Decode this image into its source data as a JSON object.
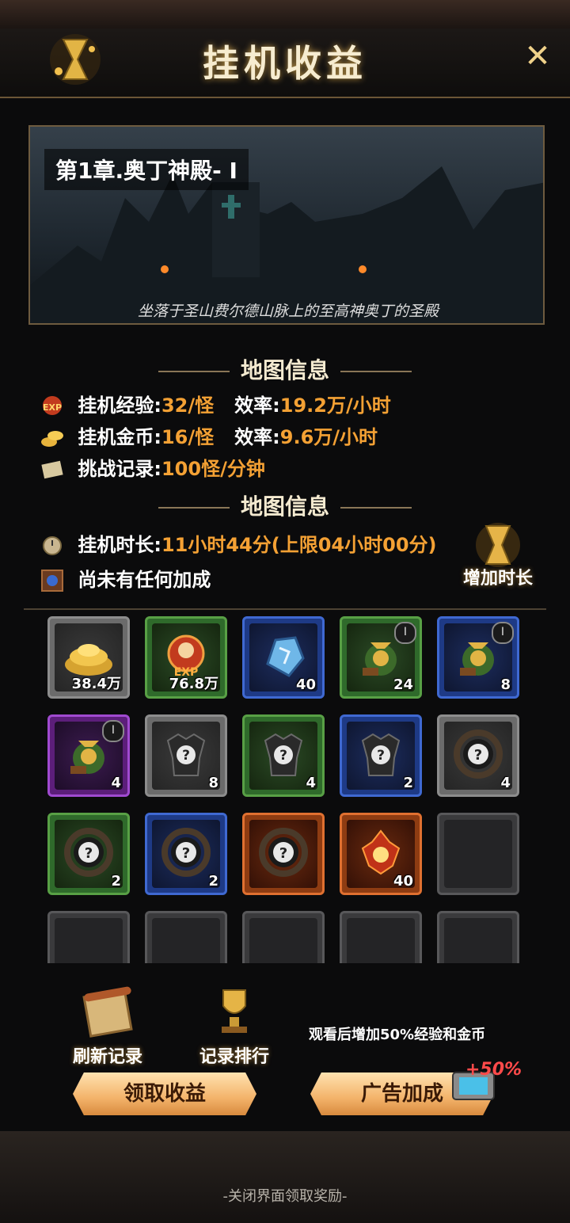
{
  "header": {
    "title": "挂机收益"
  },
  "map": {
    "chapter": "第1章.奥丁神殿- Ⅰ",
    "description": "坐落于圣山费尔德山脉上的至高神奥丁的圣殿"
  },
  "section1": {
    "title": "地图信息"
  },
  "stats": {
    "exp_label": "挂机经验:",
    "exp_value": "32/怪",
    "exp_rate_label": "效率:",
    "exp_rate_value": "19.2万/小时",
    "gold_label": "挂机金币:",
    "gold_value": "16/怪",
    "gold_rate_label": "效率:",
    "gold_rate_value": "9.6万/小时",
    "challenge_label": "挑战记录:",
    "challenge_value": "100怪/分钟"
  },
  "section2": {
    "title": "地图信息"
  },
  "idle": {
    "time_label": "挂机时长:",
    "time_value": "11小时44分(上限04小时00分)",
    "bonus_text": "尚未有任何加成",
    "add_time_label": "增加时长"
  },
  "rewards": [
    {
      "count": "38.4万",
      "quality": "gray",
      "icon": "gold-pile-icon"
    },
    {
      "count": "76.8万",
      "quality": "green",
      "icon": "exp-icon"
    },
    {
      "count": "40",
      "quality": "blue",
      "icon": "blue-stone-icon"
    },
    {
      "count": "24",
      "quality": "green",
      "icon": "loot-bag-icon",
      "badge": "Ⅰ"
    },
    {
      "count": "8",
      "quality": "blue",
      "icon": "loot-bag-icon",
      "badge": "Ⅰ"
    },
    {
      "count": "4",
      "quality": "purple",
      "icon": "loot-bag-icon",
      "badge": "Ⅰ"
    },
    {
      "count": "8",
      "quality": "gray",
      "icon": "mystery-armor-icon"
    },
    {
      "count": "4",
      "quality": "green",
      "icon": "mystery-armor-icon"
    },
    {
      "count": "2",
      "quality": "blue",
      "icon": "mystery-armor-icon"
    },
    {
      "count": "4",
      "quality": "gray",
      "icon": "mystery-ring-icon"
    },
    {
      "count": "2",
      "quality": "green",
      "icon": "mystery-ring-icon"
    },
    {
      "count": "2",
      "quality": "blue",
      "icon": "mystery-ring-icon"
    },
    {
      "count": "",
      "quality": "orange",
      "icon": "mystery-ring-icon"
    },
    {
      "count": "40",
      "quality": "orange",
      "icon": "fire-crystal-icon"
    },
    {
      "count": "",
      "quality": "empty",
      "icon": ""
    },
    {
      "count": "",
      "quality": "empty",
      "icon": ""
    },
    {
      "count": "",
      "quality": "empty",
      "icon": ""
    },
    {
      "count": "",
      "quality": "empty",
      "icon": ""
    },
    {
      "count": "",
      "quality": "empty",
      "icon": ""
    },
    {
      "count": "",
      "quality": "empty",
      "icon": ""
    }
  ],
  "actions": {
    "refresh_label": "刷新记录",
    "ranking_label": "记录排行",
    "ad_tip": "观看后增加50%经验和金币",
    "claim_label": "领取收益",
    "ad_bonus_label": "广告加成",
    "ad_bonus_badge": "+50%"
  },
  "footer": {
    "close_tip": "-关闭界面领取奖励-"
  }
}
